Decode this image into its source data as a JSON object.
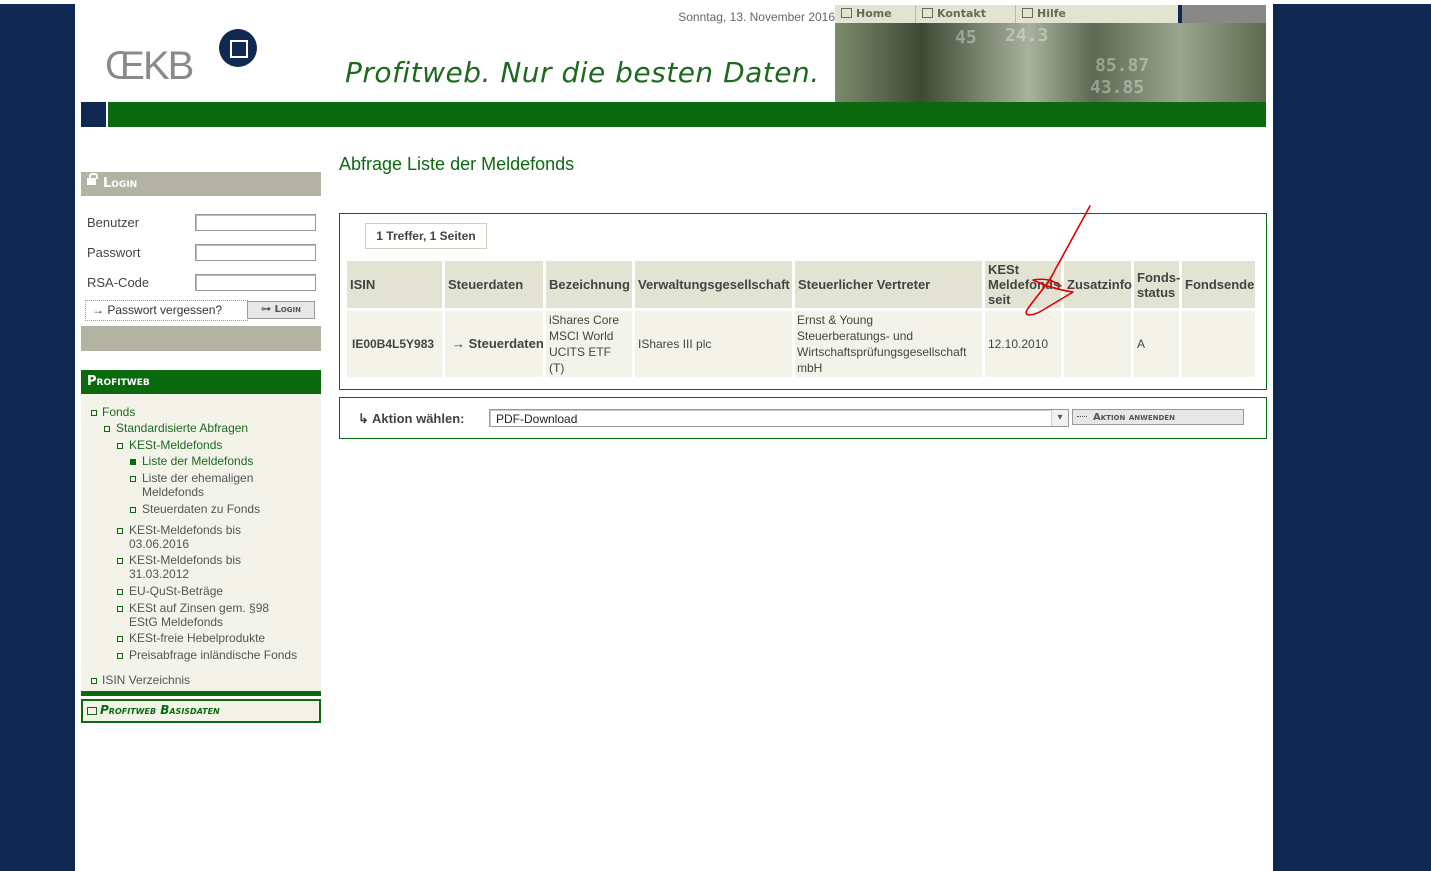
{
  "header": {
    "logo_text": "ŒKB",
    "tagline": "Profitweb. Nur die besten Daten.",
    "date": "Sonntag, 13. November 2016",
    "nav": [
      {
        "label": "Home",
        "icon": "home-icon"
      },
      {
        "label": "Kontakt",
        "icon": "mail-icon"
      },
      {
        "label": "Hilfe",
        "icon": "help-icon"
      }
    ],
    "photo_numbers": [
      "45",
      "24.3",
      "85.87",
      "43.85"
    ]
  },
  "login": {
    "title": "Login",
    "fields": [
      {
        "label": "Benutzer",
        "value": ""
      },
      {
        "label": "Passwort",
        "value": ""
      },
      {
        "label": "RSA-Code",
        "value": ""
      }
    ],
    "forgot_label": "Passwort vergessen?",
    "button_label": "Login"
  },
  "profitweb": {
    "title": "Profitweb",
    "tree": {
      "fonds": "Fonds",
      "standardisierte": "Standardisierte Abfragen",
      "kest_meldefonds": "KESt-Meldefonds",
      "liste_meldefonds": "Liste der Meldefonds",
      "liste_ehemalige_1": "Liste der ehemaligen",
      "liste_ehemalige_2": "Meldefonds",
      "steuerdaten_fonds": "Steuerdaten zu Fonds",
      "kest_bis_2016_1": "KESt-Meldefonds bis",
      "kest_bis_2016_2": "03.06.2016",
      "kest_bis_2012_1": "KESt-Meldefonds bis",
      "kest_bis_2012_2": "31.03.2012",
      "eu_qust": "EU-QuSt-Beträge",
      "kest_zinsen_1": "KESt auf Zinsen gem. §98",
      "kest_zinsen_2": "EStG Meldefonds",
      "kest_frei": "KESt-freie Hebelprodukte",
      "preisabfrage": "Preisabfrage inländische Fonds",
      "isin_verzeichnis": "ISIN Verzeichnis"
    },
    "basisdaten": "Profitweb Basisdaten"
  },
  "main": {
    "title": "Abfrage Liste der Meldefonds",
    "result_count": "1 Treffer, 1 Seiten",
    "columns": {
      "isin": "ISIN",
      "steuerdaten": "Steuerdaten",
      "bezeichnung": "Bezeichnung",
      "verwaltung": "Verwaltungsgesellschaft",
      "vertreter": "Steuerlicher Vertreter",
      "kest_1": "KESt",
      "kest_2": "Meldefonds",
      "kest_3": "seit",
      "zusatzinfo": "Zusatzinfo",
      "status_1": "Fonds-",
      "status_2": "status",
      "fondsende": "Fondsende"
    },
    "row": {
      "isin": "IE00B4L5Y983",
      "steuerdaten": "Steuerdaten",
      "bez_1": "iShares Core",
      "bez_2": "MSCI World",
      "bez_3": "UCITS ETF",
      "bez_4": "(T)",
      "verwaltung": "IShares III plc",
      "vert_1": "Ernst & Young",
      "vert_2": "Steuerberatungs- und",
      "vert_3": "Wirtschaftsprüfungsgesellschaft",
      "vert_4": "mbH",
      "kest_seit": "12.10.2010",
      "zusatzinfo": "",
      "status": "A",
      "fondsende": ""
    },
    "action_label": "Aktion wählen:",
    "action_selected": "PDF-Download",
    "apply_label": "Aktion anwenden"
  },
  "colors": {
    "brand_green": "#0b6a0e",
    "brand_blue": "#0f2952",
    "panel_grey": "#b3b3a4",
    "annotation_red": "#e00000"
  }
}
